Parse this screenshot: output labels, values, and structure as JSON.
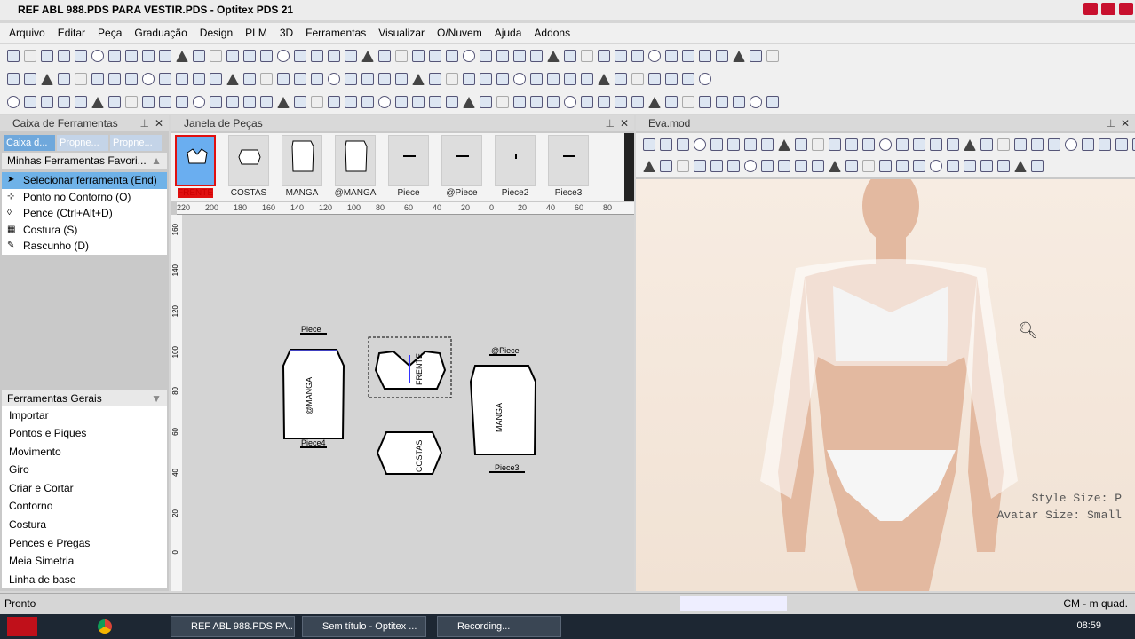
{
  "title": "REF ABL 988.PDS PARA VESTIR.PDS - Optitex PDS 21",
  "menu": [
    "Arquivo",
    "Editar",
    "Peça",
    "Graduação",
    "Design",
    "PLM",
    "3D",
    "Ferramentas",
    "Visualizar",
    "O/Nuvem",
    "Ajuda",
    "Addons"
  ],
  "toolbox": {
    "title": "Caixa de Ferramentas",
    "tabs": [
      "Caixa d...",
      "Propne...",
      "Propne..."
    ],
    "favorites": "Minhas Ferramentas Favori...",
    "items": [
      {
        "label": "Selecionar ferramenta (End)",
        "icon": "arrow-cursor-icon"
      },
      {
        "label": "Ponto no Contorno (O)",
        "icon": "point-icon"
      },
      {
        "label": "Pence (Ctrl+Alt+D)",
        "icon": "dart-icon"
      },
      {
        "label": "Costura (S)",
        "icon": "seam-icon"
      },
      {
        "label": "Rascunho (D)",
        "icon": "pencil-icon"
      }
    ],
    "group_header": "Ferramentas Gerais",
    "groups": [
      "Importar",
      "Pontos e Piques",
      "Movimento",
      "Giro",
      "Criar e Cortar",
      "Contorno",
      "Costura",
      "Pences e Pregas",
      "Meia Simetria",
      "Linha de base"
    ]
  },
  "pieces": {
    "title": "Janela de Peças",
    "items": [
      "FRENTE",
      "COSTAS",
      "MANGA",
      "@MANGA",
      "Piece",
      "@Piece",
      "Piece2",
      "Piece3"
    ],
    "ruler": [
      "220",
      "200",
      "180",
      "160",
      "140",
      "120",
      "100",
      "80",
      "60",
      "40",
      "20",
      "0",
      "20",
      "40",
      "60",
      "80"
    ],
    "vruler": [
      "160",
      "140",
      "120",
      "100",
      "80",
      "60",
      "40",
      "20",
      "0"
    ],
    "canvas_labels": {
      "piece": "Piece",
      "manga": "@MANGA",
      "frente": "FRENTE",
      "piece4": "Piece4",
      "atpiece": "@Piece",
      "mangab": "MANGA",
      "costas": "COSTAS",
      "piece3": "Piece3",
      "size": "P"
    }
  },
  "eva": {
    "title": "Eva.mod",
    "style_size": "Style Size: P",
    "avatar_size": "Avatar Size: Small"
  },
  "status": {
    "text": "Pronto",
    "units": "CM - m quad."
  },
  "taskbar": {
    "items": [
      "REF ABL 988.PDS PA...",
      "Sem título - Optitex ...",
      "Recording..."
    ],
    "time": "08:59"
  },
  "colors": {
    "selection": "#6fb2e8",
    "accent_red": "#e01010",
    "background3d": "#f3e6da"
  }
}
